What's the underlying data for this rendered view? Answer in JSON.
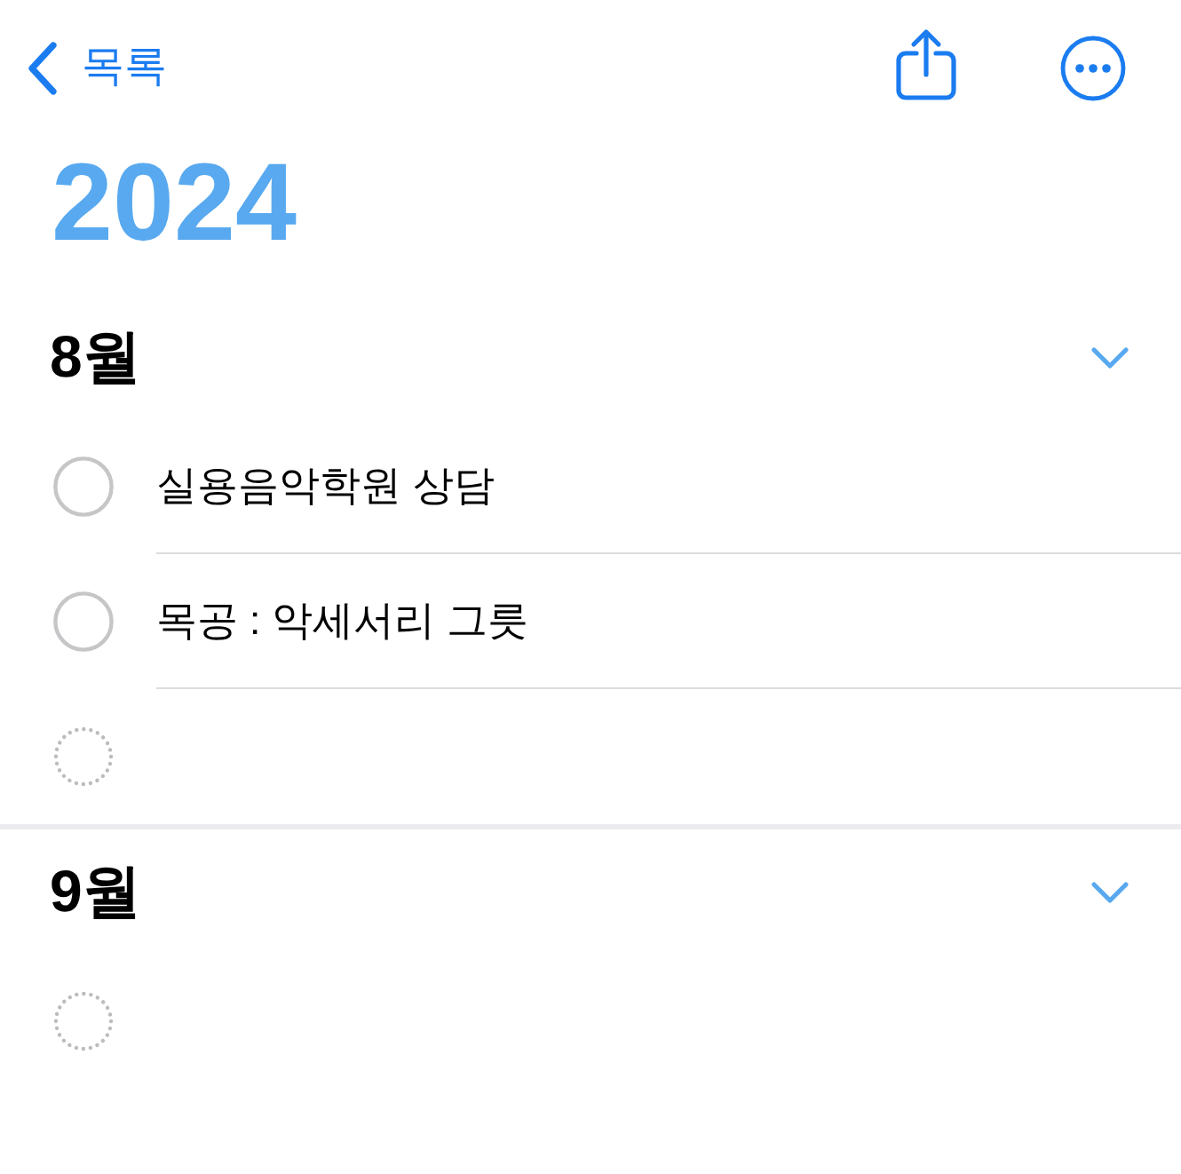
{
  "nav": {
    "back_label": "목록"
  },
  "title": "2024",
  "sections": [
    {
      "heading": "8월",
      "expanded": true,
      "items": [
        {
          "kind": "reminder",
          "text": "실용음악학원 상담",
          "completed": false
        },
        {
          "kind": "reminder",
          "text": "목공 : 악세서리 그릇",
          "completed": false
        },
        {
          "kind": "new"
        }
      ]
    },
    {
      "heading": "9월",
      "expanded": true,
      "items": [
        {
          "kind": "new"
        }
      ]
    }
  ]
}
